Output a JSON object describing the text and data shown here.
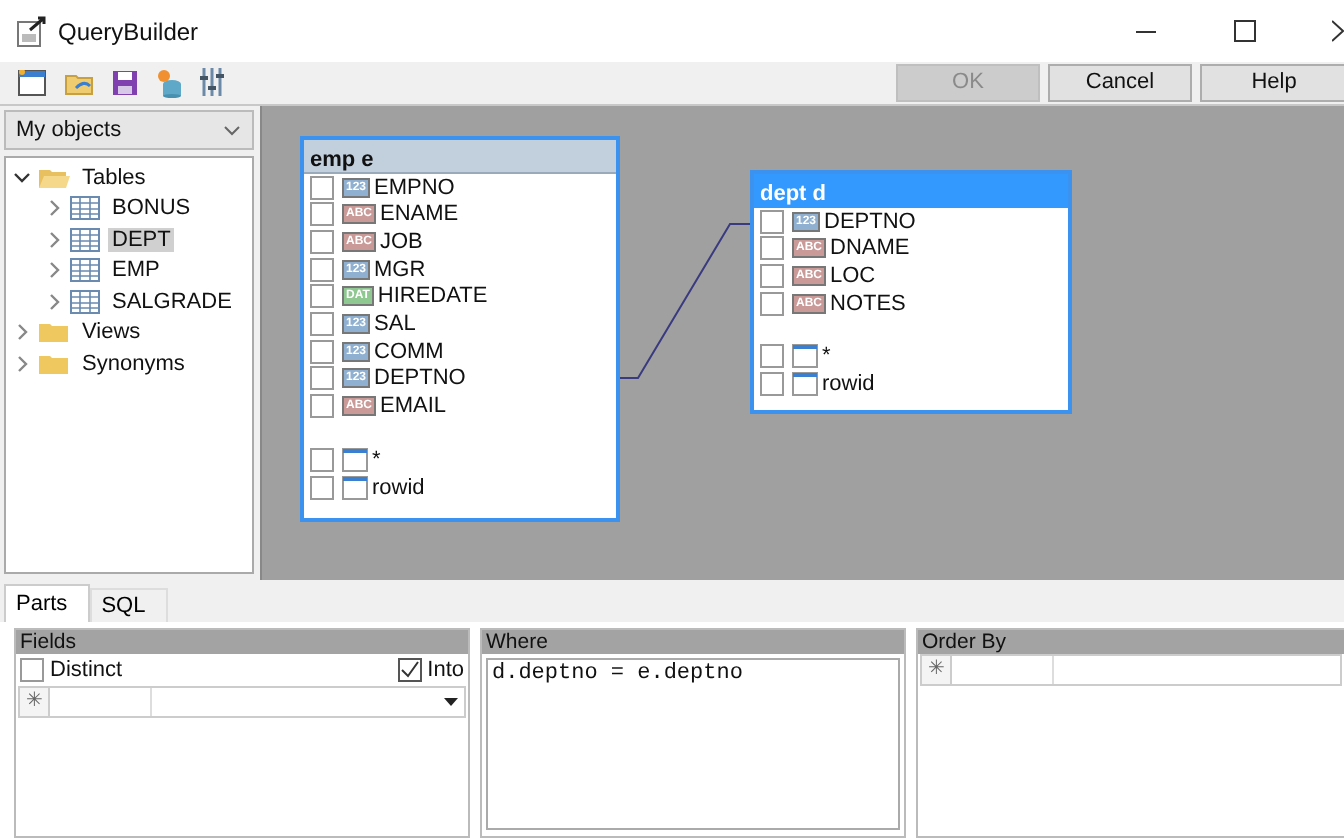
{
  "window": {
    "title": "QueryBuilder"
  },
  "buttons": [
    {
      "label": "OK",
      "disabled": true
    },
    {
      "label": "Cancel",
      "disabled": false
    },
    {
      "label": "Help",
      "disabled": false
    }
  ],
  "objects": {
    "dropdown": "My objects",
    "tree": [
      {
        "label": "Tables",
        "kind": "folder",
        "expanded": true,
        "selected": false,
        "children": [
          {
            "label": "BONUS",
            "kind": "table",
            "expanded": false,
            "selected": false
          },
          {
            "label": "DEPT",
            "kind": "table",
            "expanded": false,
            "selected": true
          },
          {
            "label": "EMP",
            "kind": "table",
            "expanded": false,
            "selected": false
          },
          {
            "label": "SALGRADE",
            "kind": "table",
            "expanded": false,
            "selected": false
          }
        ]
      },
      {
        "label": "Views",
        "kind": "folder",
        "expanded": false,
        "selected": false
      },
      {
        "label": "Synonyms",
        "kind": "folder",
        "expanded": false,
        "selected": false
      }
    ]
  },
  "canvas": {
    "tables": [
      {
        "title": "emp e",
        "selected": false,
        "columns": [
          {
            "kind": "column",
            "badge": "123",
            "color": "#8fb0d0",
            "name": "EMPNO",
            "checked": false
          },
          {
            "kind": "column",
            "badge": "ABC",
            "color": "#c99a98",
            "name": "ENAME",
            "checked": false
          },
          {
            "kind": "column",
            "badge": "ABC",
            "color": "#c99a98",
            "name": "JOB",
            "checked": false
          },
          {
            "kind": "column",
            "badge": "123",
            "color": "#8fb0d0",
            "name": "MGR",
            "checked": false
          },
          {
            "kind": "column",
            "badge": "DAT",
            "color": "#8fc890",
            "name": "HIREDATE",
            "checked": false
          },
          {
            "kind": "column",
            "badge": "123",
            "color": "#8fb0d0",
            "name": "SAL",
            "checked": false
          },
          {
            "kind": "column",
            "badge": "123",
            "color": "#8fb0d0",
            "name": "COMM",
            "checked": false
          },
          {
            "kind": "column",
            "badge": "123",
            "color": "#8fb0d0",
            "name": "DEPTNO",
            "checked": false
          },
          {
            "kind": "column",
            "badge": "ABC",
            "color": "#c99a98",
            "name": "EMAIL",
            "checked": false
          },
          {
            "kind": "special",
            "name": "*",
            "checked": false
          },
          {
            "kind": "special",
            "name": "rowid",
            "checked": false
          }
        ]
      },
      {
        "title": "dept d",
        "selected": true,
        "columns": [
          {
            "kind": "column",
            "badge": "123",
            "color": "#8fb0d0",
            "name": "DEPTNO",
            "checked": false
          },
          {
            "kind": "column",
            "badge": "ABC",
            "color": "#c99a98",
            "name": "DNAME",
            "checked": false
          },
          {
            "kind": "column",
            "badge": "ABC",
            "color": "#c99a98",
            "name": "LOC",
            "checked": false
          },
          {
            "kind": "column",
            "badge": "ABC",
            "color": "#c99a98",
            "name": "NOTES",
            "checked": false
          },
          {
            "kind": "special",
            "name": "*",
            "checked": false
          },
          {
            "kind": "special",
            "name": "rowid",
            "checked": false
          }
        ]
      }
    ]
  },
  "tabs": [
    {
      "label": "Parts",
      "selected": true
    },
    {
      "label": "SQL",
      "selected": false
    }
  ],
  "fields": {
    "title": "Fields",
    "distinct": {
      "label": "Distinct",
      "checked": false
    },
    "into": {
      "label": "Into",
      "checked": true
    },
    "grid_marker": "✳"
  },
  "where": {
    "title": "Where",
    "text": "d.deptno = e.deptno"
  },
  "order_by": {
    "title": "Order By",
    "grid_marker": "✳"
  }
}
